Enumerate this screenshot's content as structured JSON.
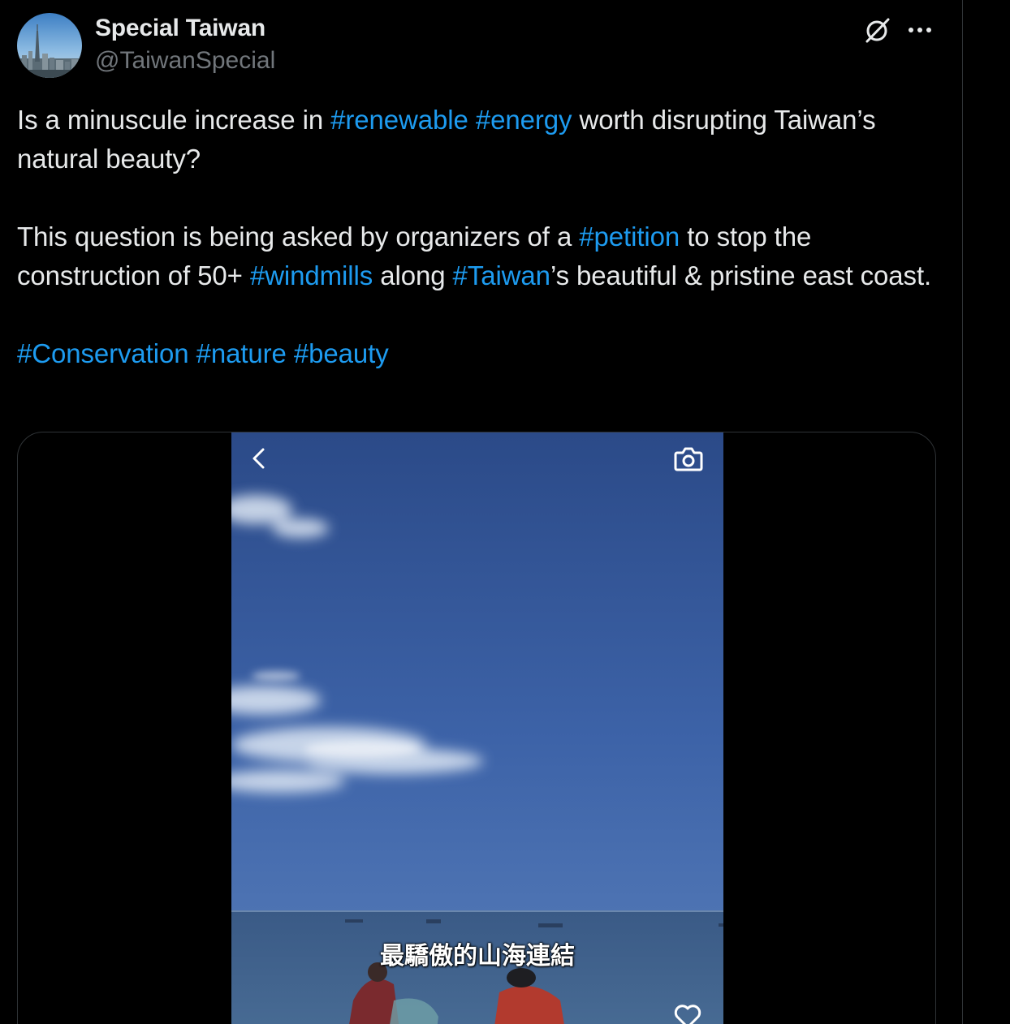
{
  "author": {
    "display_name": "Special Taiwan",
    "handle": "@TaiwanSpecial",
    "avatar_icon": "city-skyline-avatar"
  },
  "actions": {
    "grok_icon": "grok-icon",
    "more_icon": "more-horizontal-icon"
  },
  "tweet": {
    "p1": {
      "t1": "Is a minuscule increase in ",
      "h1": "#renewable",
      "t2": " ",
      "h2": "#energy",
      "t3": " worth disrupting Taiwan’s natural beauty?"
    },
    "p2": {
      "t1": "This question is being asked by organizers of a ",
      "h1": "#petition",
      "t2": " to stop the construction of 50+ ",
      "h2": "#windmills",
      "t3": " along ",
      "h3": "#Taiwan",
      "t4": "’s beautiful & pristine east coast."
    },
    "p3": {
      "h1": "#Conservation",
      "t1": " ",
      "h2": "#nature",
      "t2": " ",
      "h3": "#beauty"
    }
  },
  "media": {
    "caption": "最驕傲的山海連結",
    "back_icon": "chevron-left-icon",
    "camera_icon": "camera-icon",
    "heart_icon": "heart-icon"
  },
  "colors": {
    "background": "#000000",
    "text": "#e7e9ea",
    "secondary": "#71767b",
    "hashtag": "#1d9bf0",
    "border": "#2f3336"
  }
}
